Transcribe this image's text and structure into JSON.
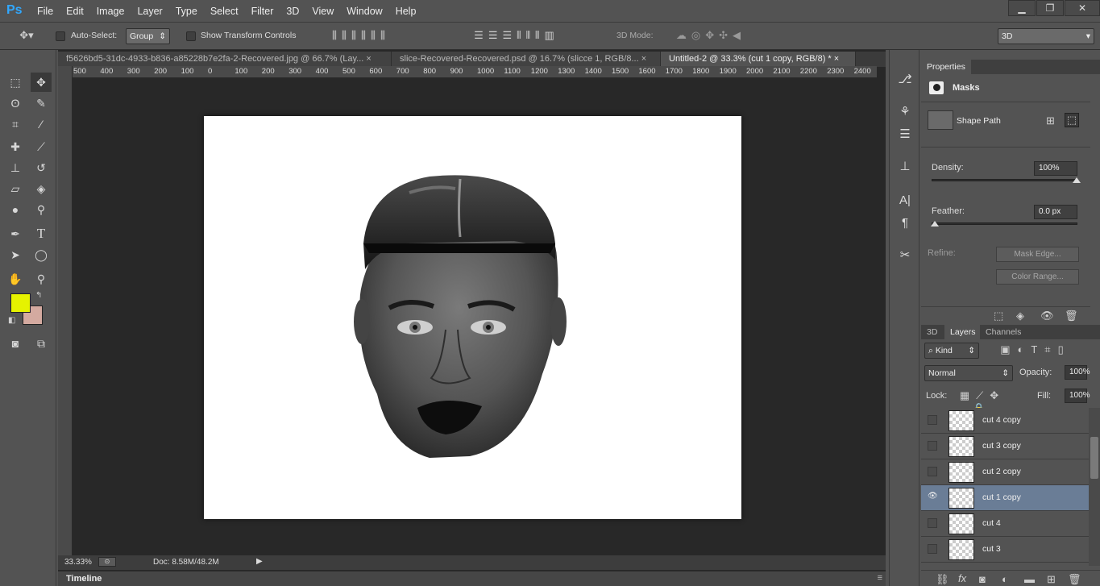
{
  "app": {
    "logo": "Ps"
  },
  "menu": [
    "File",
    "Edit",
    "Image",
    "Layer",
    "Type",
    "Select",
    "Filter",
    "3D",
    "View",
    "Window",
    "Help"
  ],
  "window_controls": {
    "minimize": "▁",
    "restore": "❐",
    "close": "✕"
  },
  "options": {
    "auto_select_label": "Auto-Select:",
    "auto_select_value": "Group",
    "show_transform_label": "Show Transform Controls",
    "mode_3d_label": "3D Mode:",
    "workspace": "3D"
  },
  "tabs": [
    {
      "label": "f5626bd5-31dc-4933-b836-a85228b7e2fa-2-Recovered.jpg @ 66.7% (Lay...",
      "active": false
    },
    {
      "label": "slice-Recovered-Recovered.psd @ 16.7% (slicce 1, RGB/8...",
      "active": false
    },
    {
      "label": "Untitled-2 @ 33.3% (cut 1 copy, RGB/8) *",
      "active": true
    }
  ],
  "ruler_ticks": [
    "500",
    "400",
    "300",
    "200",
    "100",
    "0",
    "100",
    "200",
    "300",
    "400",
    "500",
    "600",
    "700",
    "800",
    "900",
    "1000",
    "1100",
    "1200",
    "1300",
    "1400",
    "1500",
    "1600",
    "1700",
    "1800",
    "1900",
    "2000",
    "2100",
    "2200",
    "2300",
    "2400"
  ],
  "status": {
    "zoom": "33.33%",
    "doc": "Doc: 8.58M/48.2M"
  },
  "timeline_label": "Timeline",
  "properties": {
    "tab": "Properties",
    "section": "Masks",
    "shape_label": "Shape Path",
    "density_label": "Density:",
    "density_value": "100%",
    "density": 1.0,
    "feather_label": "Feather:",
    "feather_value": "0.0 px",
    "feather": 0.0,
    "refine_label": "Refine:",
    "mask_edge": "Mask Edge...",
    "color_range": "Color Range..."
  },
  "layers_panel": {
    "tabs": [
      "3D",
      "Layers",
      "Channels"
    ],
    "active_tab": "Layers",
    "kind": "Kind",
    "blend": "Normal",
    "opacity_label": "Opacity:",
    "opacity_value": "100%",
    "lock_label": "Lock:",
    "fill_label": "Fill:",
    "fill_value": "100%",
    "items": [
      {
        "name": "cut 4 copy",
        "visible": false,
        "selected": false
      },
      {
        "name": "cut 3 copy",
        "visible": false,
        "selected": false
      },
      {
        "name": "cut 2 copy",
        "visible": false,
        "selected": false
      },
      {
        "name": "cut 1 copy",
        "visible": true,
        "selected": true
      },
      {
        "name": "cut 4",
        "visible": false,
        "selected": false
      },
      {
        "name": "cut 3",
        "visible": false,
        "selected": false
      }
    ]
  },
  "colors": {
    "foreground": "#e6f200",
    "background": "#d4aaa0",
    "accent": "#31a8ff",
    "selected_row": "#6a7d96"
  }
}
